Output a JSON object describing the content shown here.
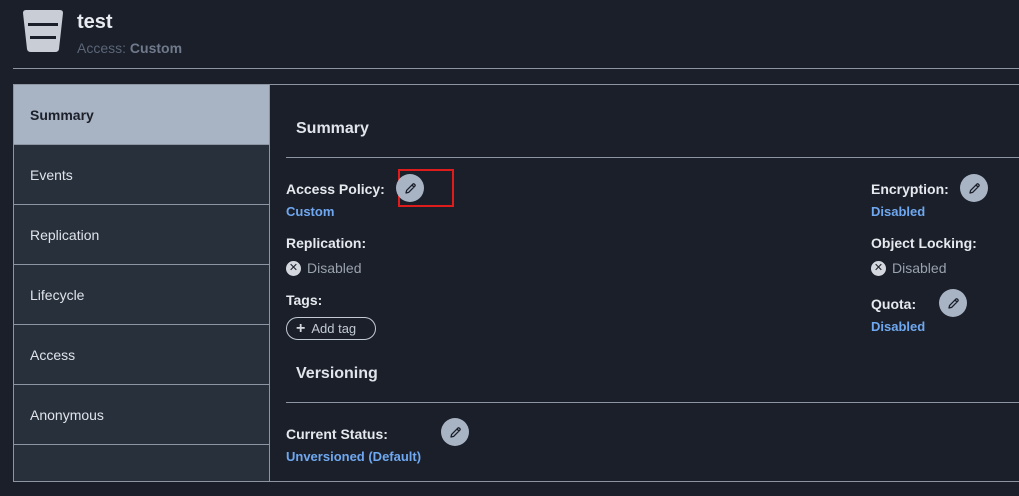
{
  "header": {
    "title": "test",
    "access_label": "Access:",
    "access_value": "Custom"
  },
  "sidebar": {
    "items": [
      {
        "label": "Summary",
        "active": true
      },
      {
        "label": "Events"
      },
      {
        "label": "Replication"
      },
      {
        "label": "Lifecycle"
      },
      {
        "label": "Access"
      },
      {
        "label": "Anonymous"
      }
    ]
  },
  "summary": {
    "title": "Summary",
    "access_policy": {
      "label": "Access Policy:",
      "value": "Custom"
    },
    "replication": {
      "label": "Replication:",
      "value": "Disabled"
    },
    "tags": {
      "label": "Tags:",
      "add_label": "Add tag"
    },
    "encryption": {
      "label": "Encryption:",
      "value": "Disabled"
    },
    "object_locking": {
      "label": "Object Locking:",
      "value": "Disabled"
    },
    "quota": {
      "label": "Quota:",
      "value": "Disabled"
    }
  },
  "versioning": {
    "title": "Versioning",
    "current_status": {
      "label": "Current Status:",
      "value": "Unversioned (Default)"
    }
  },
  "icons": {
    "bucket": "bucket-icon",
    "edit": "pencil-icon",
    "disabled": "x-circle-icon",
    "add": "plus-icon"
  },
  "colors": {
    "background": "#1a1f29",
    "sidebar": "#28303c",
    "active_item": "#a8b3c4",
    "link": "#6fa8f0",
    "highlight": "#e01b1b"
  }
}
